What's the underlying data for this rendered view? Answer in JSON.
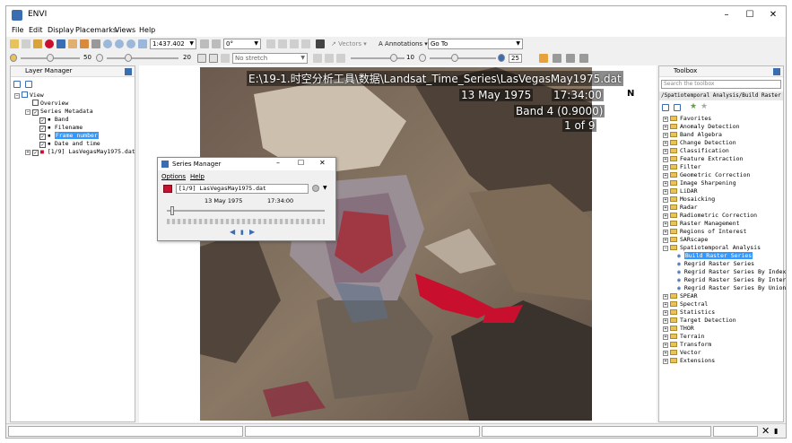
{
  "window": {
    "title": "ENVI",
    "minimize": "–",
    "maximize": "☐",
    "close": "✕"
  },
  "menu": [
    "File",
    "Edit",
    "Display",
    "Placemarks",
    "Views",
    "Help"
  ],
  "toolbar1": {
    "scale": "1:437.402",
    "rotation": "0°",
    "vectors": "Vectors",
    "annotations": "Annotations",
    "goto": "Go To"
  },
  "toolbar2": {
    "value1": "50",
    "value2": "20",
    "stretch": "No stretch",
    "value3": "10",
    "value4": "25"
  },
  "layer_manager": {
    "title": "Layer Manager",
    "items": [
      {
        "label": "View",
        "level": 0
      },
      {
        "label": "Overview",
        "level": 1
      },
      {
        "label": "Series Metadata",
        "level": 1
      },
      {
        "label": "Band",
        "level": 2
      },
      {
        "label": "Filename",
        "level": 2
      },
      {
        "label": "Frame number",
        "level": 2,
        "selected": true
      },
      {
        "label": "Date and time",
        "level": 2
      },
      {
        "label": "[1/9] LasVegasMay1975.dat",
        "level": 1
      }
    ]
  },
  "image_overlay": {
    "filename": "E:\\19-1.时空分析工具\\数据\\Landsat_Time_Series\\LasVegasMay1975.dat",
    "date": "13 May 1975",
    "time": "17:34:00",
    "band": "Band 4 (0.9000)",
    "frame": "1 of 9",
    "north": "N"
  },
  "series_manager": {
    "title": "Series Manager",
    "menu_options": "Options",
    "menu_help": "Help",
    "file": "[1/9] LasVegasMay1975.dat",
    "date": "13 May 1975",
    "time": "17:34:00"
  },
  "toolbox": {
    "title": "Toolbox",
    "search_placeholder": "Search the toolbox",
    "path": "/Spatiotemporal Analysis/Build Raster Se",
    "items": [
      {
        "label": "Favorites",
        "level": 0
      },
      {
        "label": "Anomaly Detection",
        "level": 0
      },
      {
        "label": "Band Algebra",
        "level": 0
      },
      {
        "label": "Change Detection",
        "level": 0
      },
      {
        "label": "Classification",
        "level": 0
      },
      {
        "label": "Feature Extraction",
        "level": 0
      },
      {
        "label": "Filter",
        "level": 0
      },
      {
        "label": "Geometric Correction",
        "level": 0
      },
      {
        "label": "Image Sharpening",
        "level": 0
      },
      {
        "label": "LiDAR",
        "level": 0
      },
      {
        "label": "Mosaicking",
        "level": 0
      },
      {
        "label": "Radar",
        "level": 0
      },
      {
        "label": "Radiometric Correction",
        "level": 0
      },
      {
        "label": "Raster Management",
        "level": 0
      },
      {
        "label": "Regions of Interest",
        "level": 0
      },
      {
        "label": "SARscape",
        "level": 0
      },
      {
        "label": "Spatiotemporal Analysis",
        "level": 0,
        "expanded": true
      },
      {
        "label": "Build Raster Series",
        "level": 1,
        "selected": true
      },
      {
        "label": "Regrid Raster Series",
        "level": 1
      },
      {
        "label": "Regrid Raster Series By Index",
        "level": 1
      },
      {
        "label": "Regrid Raster Series By Inters",
        "level": 1
      },
      {
        "label": "Regrid Raster Series By Union",
        "level": 1
      },
      {
        "label": "SPEAR",
        "level": 0
      },
      {
        "label": "Spectral",
        "level": 0
      },
      {
        "label": "Statistics",
        "level": 0
      },
      {
        "label": "Target Detection",
        "level": 0
      },
      {
        "label": "THOR",
        "level": 0
      },
      {
        "label": "Terrain",
        "level": 0
      },
      {
        "label": "Transform",
        "level": 0
      },
      {
        "label": "Vector",
        "level": 0
      },
      {
        "label": "Extensions",
        "level": 0
      }
    ]
  },
  "colors": {
    "accent": "#3399ff",
    "folder": "#e8c25a",
    "urban_red": "#c8102e"
  }
}
